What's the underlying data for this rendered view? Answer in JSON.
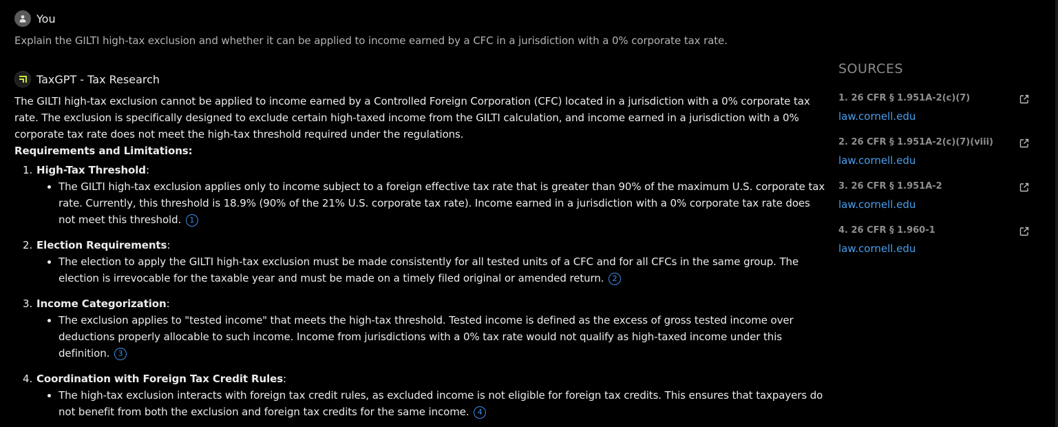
{
  "user": {
    "name": "You",
    "question": "Explain the GILTI high-tax exclusion and whether it can be applied to income earned by a CFC in a jurisdiction with a 0% corporate tax rate."
  },
  "assistant": {
    "name": "TaxGPT - Tax Research",
    "intro": "The GILTI high-tax exclusion cannot be applied to income earned by a Controlled Foreign Corporation (CFC) located in a jurisdiction with a 0% corporate tax rate. The exclusion is specifically designed to exclude certain high-taxed income from the GILTI calculation, and income earned in a jurisdiction with a 0% corporate tax rate does not meet the high-tax threshold required under the regulations.",
    "section_heading": "Requirements and Limitations:",
    "items": [
      {
        "number": "1.",
        "title": "High-Tax Threshold",
        "bullet": "The GILTI high-tax exclusion applies only to income subject to a foreign effective tax rate that is greater than 90% of the maximum U.S. corporate tax rate. Currently, this threshold is 18.9% (90% of the 21% U.S. corporate tax rate). Income earned in a jurisdiction with a 0% corporate tax rate does not meet this threshold.",
        "citation": "1"
      },
      {
        "number": "2.",
        "title": "Election Requirements",
        "bullet": "The election to apply the GILTI high-tax exclusion must be made consistently for all tested units of a CFC and for all CFCs in the same group. The election is irrevocable for the taxable year and must be made on a timely filed original or amended return.",
        "citation": "2"
      },
      {
        "number": "3.",
        "title": "Income Categorization",
        "bullet": "The exclusion applies to \"tested income\" that meets the high-tax threshold. Tested income is defined as the excess of gross tested income over deductions properly allocable to such income. Income from jurisdictions with a 0% tax rate would not qualify as high-taxed income under this definition.",
        "citation": "3"
      },
      {
        "number": "4.",
        "title": "Coordination with Foreign Tax Credit Rules",
        "bullet": "The high-tax exclusion interacts with foreign tax credit rules, as excluded income is not eligible for foreign tax credits. This ensures that taxpayers do not benefit from both the exclusion and foreign tax credits for the same income.",
        "citation": "4"
      }
    ]
  },
  "sources": {
    "title": "SOURCES",
    "items": [
      {
        "name": "1. 26 CFR § 1.951A-2(c)(7)",
        "link": "law.cornell.edu"
      },
      {
        "name": "2. 26 CFR § 1.951A-2(c)(7)(viii)",
        "link": "law.cornell.edu"
      },
      {
        "name": "3. 26 CFR § 1.951A-2",
        "link": "law.cornell.edu"
      },
      {
        "name": "4. 26 CFR § 1.960-1",
        "link": "law.cornell.edu"
      }
    ]
  },
  "icons": {
    "user_avatar": "person-icon",
    "bot_avatar": "taxgpt-logo-icon",
    "external": "external-link-icon"
  },
  "colors": {
    "background": "#000000",
    "link": "#4a9ff0",
    "citation": "#3d8ee8",
    "logo_accent": "#c8e63c"
  }
}
